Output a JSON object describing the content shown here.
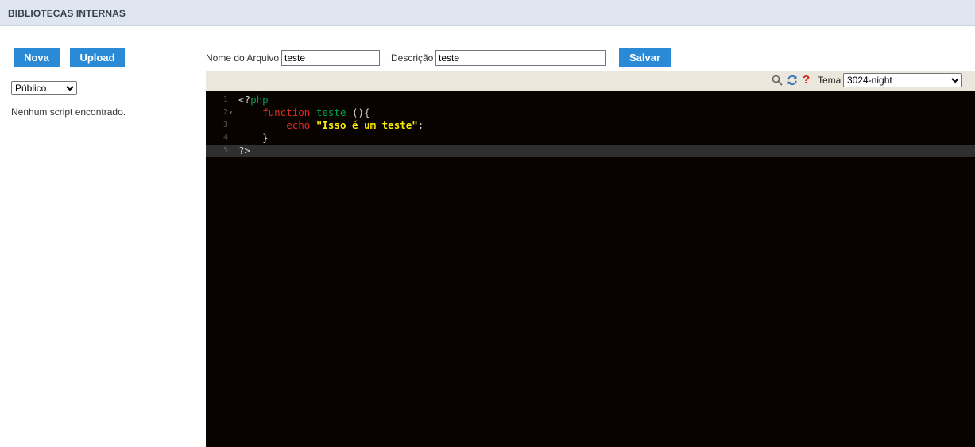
{
  "header": {
    "title": "BIBLIOTECAS INTERNAS"
  },
  "sidebar": {
    "new_label": "Nova",
    "upload_label": "Upload",
    "visibility_selected": "Público",
    "empty_message": "Nenhum script encontrado."
  },
  "form": {
    "filename_label": "Nome do Arquivo",
    "filename_value": "teste",
    "description_label": "Descrição",
    "description_value": "teste",
    "save_label": "Salvar"
  },
  "toolbar": {
    "help_glyph": "?",
    "theme_label": "Tema",
    "theme_selected": "3024-night",
    "icons": [
      "search-icon",
      "refresh-icon",
      "help-icon"
    ]
  },
  "editor": {
    "theme_colors": {
      "background": "#090300",
      "keyword": "#db2d20",
      "function": "#01a252",
      "string": "#fded02",
      "text": "#d6d5d4"
    },
    "active_line": 5,
    "lines": [
      {
        "num": "1",
        "fold": "",
        "tokens": [
          {
            "t": "<?",
            "c": "t-tag"
          },
          {
            "t": "php",
            "c": "t-php"
          }
        ]
      },
      {
        "num": "2",
        "fold": "▾",
        "tokens": [
          {
            "t": "    ",
            "c": "t-plain"
          },
          {
            "t": "function",
            "c": "t-kw"
          },
          {
            "t": " ",
            "c": "t-plain"
          },
          {
            "t": "teste",
            "c": "t-fn"
          },
          {
            "t": " (){",
            "c": "t-plain"
          }
        ]
      },
      {
        "num": "3",
        "fold": "",
        "tokens": [
          {
            "t": "        ",
            "c": "t-plain"
          },
          {
            "t": "echo",
            "c": "t-kw"
          },
          {
            "t": " ",
            "c": "t-plain"
          },
          {
            "t": "\"Isso é um teste\"",
            "c": "t-str"
          },
          {
            "t": ";",
            "c": "t-plain"
          }
        ]
      },
      {
        "num": "4",
        "fold": "",
        "tokens": [
          {
            "t": "    }",
            "c": "t-plain"
          }
        ]
      },
      {
        "num": "5",
        "fold": "",
        "tokens": [
          {
            "t": "?>",
            "c": "t-tag"
          }
        ]
      }
    ]
  }
}
